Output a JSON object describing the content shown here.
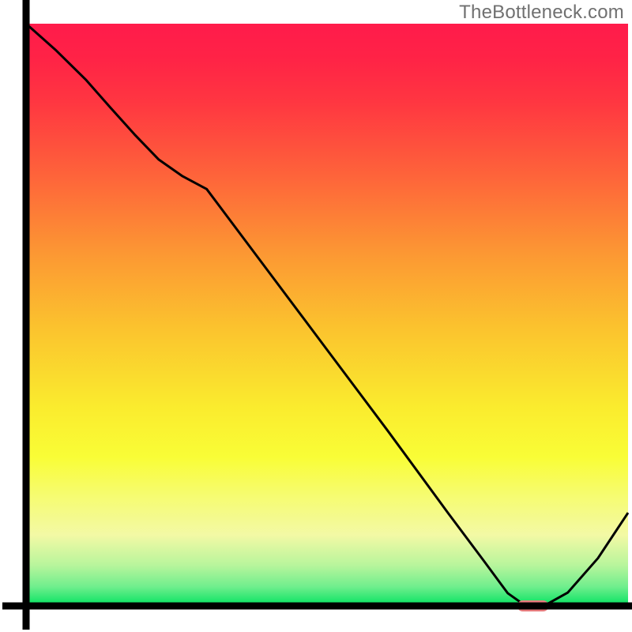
{
  "watermark": "TheBottleneck.com",
  "chart_data": {
    "type": "line",
    "x": [
      0.0,
      0.05,
      0.1,
      0.14,
      0.18,
      0.22,
      0.26,
      0.3,
      0.4,
      0.5,
      0.6,
      0.7,
      0.76,
      0.8,
      0.83,
      0.86,
      0.9,
      0.95,
      1.0
    ],
    "values": [
      1.0,
      0.954,
      0.903,
      0.856,
      0.81,
      0.767,
      0.738,
      0.716,
      0.578,
      0.44,
      0.302,
      0.161,
      0.078,
      0.022,
      0.0,
      0.0,
      0.023,
      0.082,
      0.16
    ],
    "marker": {
      "x": [
        0.816,
        0.868
      ],
      "y": 0.0
    },
    "xlim": [
      0,
      1
    ],
    "ylim": [
      0,
      1
    ],
    "xlabel": "",
    "ylabel": "",
    "title": "",
    "gradient_stops": [
      {
        "position": 0.0,
        "color": "#FF1B4B"
      },
      {
        "position": 0.06,
        "color": "#FF2346"
      },
      {
        "position": 0.134,
        "color": "#FF3641"
      },
      {
        "position": 0.262,
        "color": "#FE643A"
      },
      {
        "position": 0.396,
        "color": "#FC9833"
      },
      {
        "position": 0.523,
        "color": "#FBC32E"
      },
      {
        "position": 0.66,
        "color": "#FAEC2E"
      },
      {
        "position": 0.744,
        "color": "#F9FD36"
      },
      {
        "position": 0.81,
        "color": "#F6FC70"
      },
      {
        "position": 0.878,
        "color": "#F3F9A5"
      },
      {
        "position": 0.93,
        "color": "#B8F59C"
      },
      {
        "position": 0.967,
        "color": "#70EE8D"
      },
      {
        "position": 0.99,
        "color": "#24E66E"
      },
      {
        "position": 1.0,
        "color": "#00E261"
      }
    ],
    "marker_color": "#E77C7E",
    "axis_color": "#000000",
    "line_color": "#000000"
  }
}
